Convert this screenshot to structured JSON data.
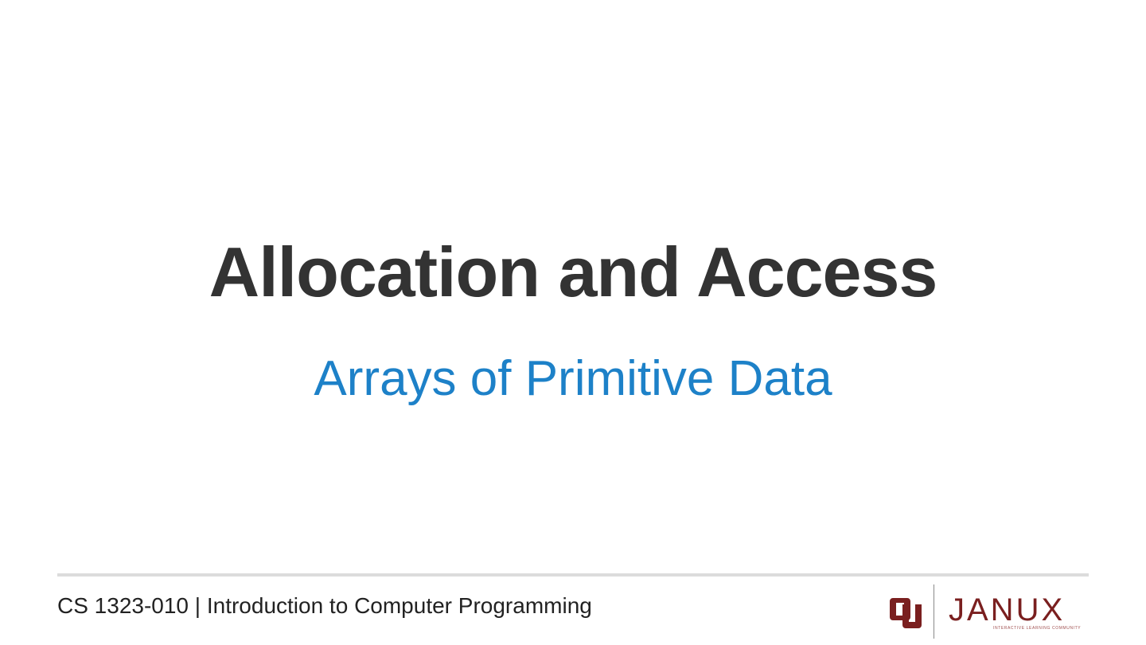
{
  "slide": {
    "title": "Allocation and Access",
    "subtitle": "Arrays of Primitive Data"
  },
  "footer": {
    "course": "CS 1323-010 | Introduction to Computer Programming",
    "logo": {
      "ou_icon": "ou-interlocking-logo-icon",
      "wordmark": "JANUX",
      "tagline": "INTERACTIVE LEARNING COMMUNITY"
    }
  },
  "colors": {
    "title": "#333333",
    "subtitle": "#1d81c8",
    "brand_crimson": "#7a1f1f",
    "rule": "#dcdcdc"
  }
}
